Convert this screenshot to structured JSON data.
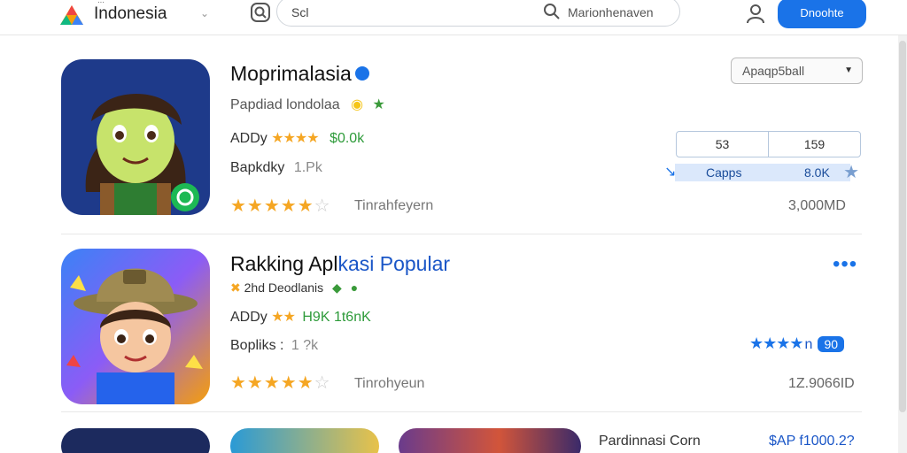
{
  "header": {
    "brand_small": "···",
    "brand": "Indonesia",
    "search_placeholder": "Scl",
    "search_hint": "Marionhenaven",
    "primary_button": "Dnoohte"
  },
  "apps": [
    {
      "title": "Moprimalasia",
      "developer": "Papdiad londolaa",
      "meta_prefix": "ADDy",
      "meta_stars": "★★★★",
      "meta_price": "$0.0k",
      "downloads_label": "Bapkdky",
      "downloads_value": "1.Pk",
      "trend_label": "Tinrahfeyern",
      "count": "3,000MD"
    },
    {
      "title_part1": "Rakking Apl",
      "title_part2": "kasi Popular",
      "developer": "2hd Deodlanis",
      "meta_prefix": "ADDy",
      "meta_stars": "★★",
      "meta_price": "H9K  1t6nK",
      "downloads_label": "Bopliks :",
      "downloads_value": "1 ?k",
      "trend_label": "Tinrohyeun",
      "count": "1Z.9066ID"
    }
  ],
  "filter": {
    "select_label": "Apaqp5ball"
  },
  "stats": {
    "seg_left": "53",
    "seg_right": "159",
    "bar_label": "Capps",
    "bar_value": "8.0K"
  },
  "row2_rating": {
    "number": "n",
    "badge": "90"
  },
  "bottom": {
    "label": "Pardinnasi Corn",
    "price": "$AP f1000.2?"
  },
  "colors": {
    "accent": "#1a73e8",
    "star": "#f5a623",
    "green": "#2e9b3a"
  }
}
